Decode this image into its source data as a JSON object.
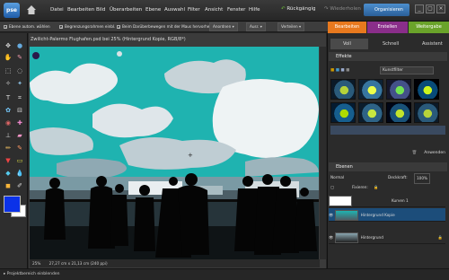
{
  "app": {
    "logo": "pse"
  },
  "menu": [
    "Datei",
    "Bearbeiten",
    "Bild",
    "Überarbeiten",
    "Ebene",
    "Auswahl",
    "Filter",
    "Ansicht",
    "Fenster",
    "Hilfe"
  ],
  "undo": {
    "undo": "Rückgängig",
    "redo": "Wiederholen"
  },
  "organize": "Organisieren",
  "window_buttons": [
    "_",
    "▢",
    "×"
  ],
  "options": {
    "auto_select": "Ebene autom. wählen",
    "bounding_box": "Begrenzungsrahmen einbl.",
    "hover": "Beim Darüberbewegen mit der Maus hervorheben",
    "arrange": "Anordnen",
    "align": "Ausr.",
    "distribute": "Verteilen"
  },
  "mode_tabs": [
    "Bearbeiten",
    "Erstellen",
    "Weitergabe"
  ],
  "sub_tabs": [
    "Voll",
    "Schnell",
    "Assistent"
  ],
  "document": {
    "title": "Zwilicht-Palermo Flughafen.psd bei 25% (Hintergrund Kopie, RGB/8*)",
    "zoom": "25%",
    "dimensions": "27,27 cm x 21,13 cm (240 ppi)"
  },
  "effects": {
    "title": "Effekte",
    "category": "Kunstfilter",
    "apply": "Anwenden"
  },
  "layers": {
    "title": "Ebenen",
    "blend": "Normal",
    "opacity_label": "Deckkraft:",
    "opacity": "100%",
    "lock_label": "Fixieren:",
    "items": [
      {
        "name": "Kurven 1"
      },
      {
        "name": "Hintergrund Kopie"
      },
      {
        "name": "Hintergrund"
      }
    ]
  },
  "status": "Projektbereich einblenden",
  "colors": {
    "foreground": "#0b32e8",
    "background": "#ffffff",
    "bearbeiten_tab": "#e8791e",
    "erstellen_tab": "#8a2e8a",
    "weitergabe_tab": "#6aa32a"
  }
}
